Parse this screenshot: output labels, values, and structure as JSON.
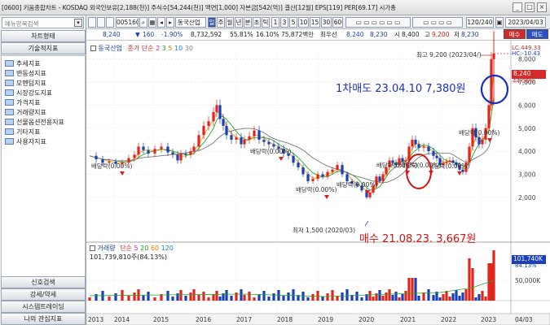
{
  "window": {
    "title": "[0600] 키움종합차트 - KOSDAQ 외국인보유[2,188(천)] 주식수[54,244(천)] 액면[1,000] 자본금[542(억)] 결산[12월] EPS[119] PER[69.17] 시가총",
    "controls": [
      "_",
      "□",
      "×"
    ]
  },
  "sidebar": {
    "search_placeholder": "메뉴항목검색",
    "search_btn": "▾",
    "tab_chart_type": "차트형태",
    "tab_indicators": "기술적지표",
    "tree_items": [
      "추세지표",
      "변동성지표",
      "모멘텀지표",
      "시장강도지표",
      "가격지표",
      "거래량지표",
      "선물옵션전용지표",
      "기타지표",
      "사용자지표"
    ],
    "bottom_buttons": [
      "신호검색",
      "강세/약세",
      "시스템트레이딩",
      "나의 관심지표"
    ]
  },
  "toolbar": {
    "code": "005160",
    "stock_name": "동국산업",
    "periods": [
      "일",
      "주",
      "월",
      "년",
      "분",
      "초",
      "틱"
    ],
    "numbers": [
      "1",
      "3",
      "5",
      "10",
      "15",
      "30",
      "60"
    ],
    "view_count": "120/240",
    "date": "2023/04/03"
  },
  "quote": {
    "price": "8,240",
    "change": "160",
    "rate": "-1.90%",
    "volume": "8,732,592",
    "turnover": "55.81%",
    "ratio2": "16.10%",
    "amount": "75,872백만",
    "best_ask_label": "최우선",
    "ask": "8,240",
    "bid": "8,230",
    "low_label": "시",
    "open": "8,400",
    "high_label": "고",
    "high": "9,200",
    "low_label2": "저",
    "low": "8,230",
    "buy": "매수",
    "sell": "매도"
  },
  "chart": {
    "legend_name": "동국산업",
    "legend_ma_label": "종가 단순",
    "legend_ma": [
      "2",
      "3",
      "5",
      "10",
      "30"
    ],
    "vol_legend_name": "거래량",
    "vol_legend_ma_label": "단순",
    "vol_legend_ma": [
      "5",
      "20",
      "60",
      "120"
    ],
    "vol_value": "101,739,810주(84.13%)",
    "lc": "LC:449.33",
    "hc": "HC:-10.43",
    "current_price_tag": "8,240",
    "current_pct_tag": "44.06%",
    "vol_tag": "101,740K",
    "vol_pct_tag": "84.13%",
    "max_label": "최고 9,200 (2023/04/)",
    "min_label": "최저 1,500 (2020/03)",
    "sell_annotation": "1차매도 23.04.10 7,380원",
    "buy_annotation": "매수 21.08.23. 3,667원",
    "div_label": "배당락(0.00%)",
    "y_ticks": [
      "8,000",
      "7,000",
      "6,000",
      "5,000",
      "4,000",
      "3,000",
      "2,000"
    ],
    "vol_ticks": [
      "50,000K"
    ],
    "x_ticks": [
      "2013",
      "2014",
      "2015",
      "2016",
      "2017",
      "2018",
      "2019",
      "2020",
      "2021",
      "2022",
      "2023",
      "04/03"
    ],
    "colors": {
      "up": "#e0261d",
      "down": "#1b3fb5",
      "ma_green": "#2aa52a",
      "ma_orange": "#e89a00",
      "ma_gray": "#777777",
      "annot_blue": "#1a2fbf",
      "annot_red": "#d41414"
    }
  }
}
